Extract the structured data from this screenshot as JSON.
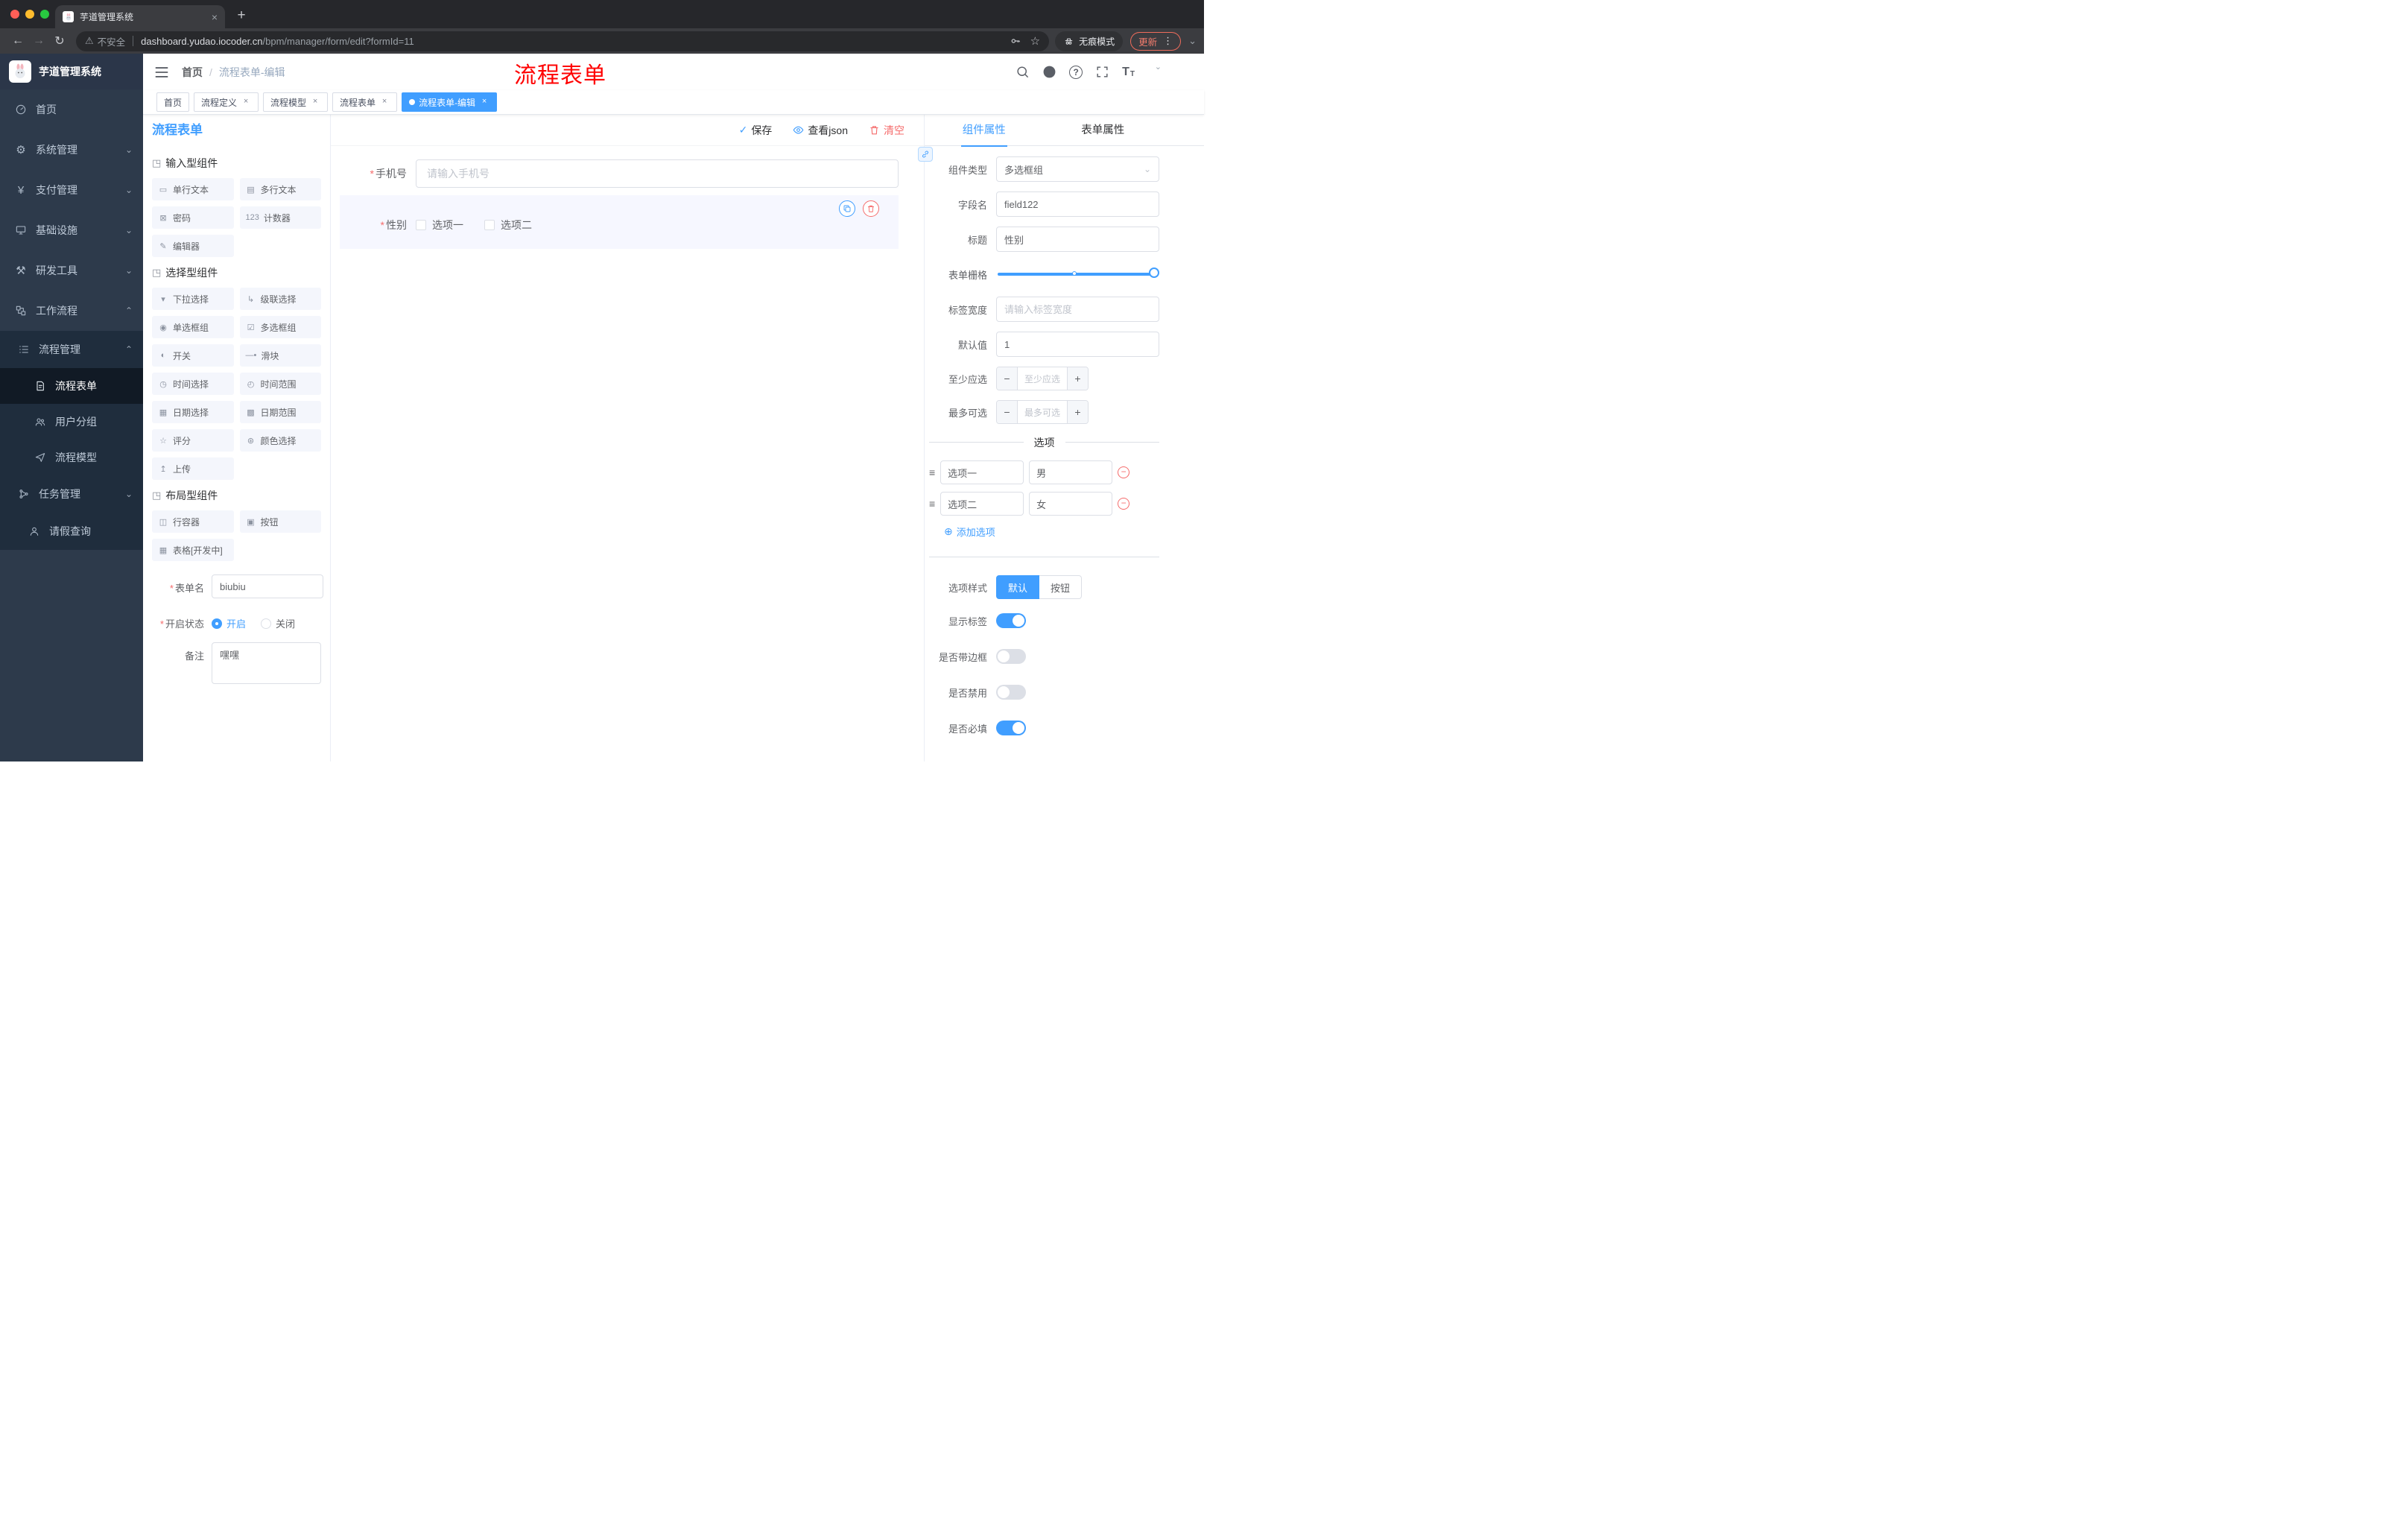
{
  "browser": {
    "tab_title": "芋道管理系统",
    "not_secure": "不安全",
    "url_domain": "dashboard.yudao.iocoder.cn",
    "url_path": "/bpm/manager/form/edit?formId=11",
    "incognito": "无痕模式",
    "update": "更新"
  },
  "sidebar": {
    "logo_title": "芋道管理系统",
    "items": [
      {
        "label": "首页",
        "icon": "gauge-icon"
      },
      {
        "label": "系统管理",
        "icon": "gear-icon"
      },
      {
        "label": "支付管理",
        "icon": "yen-icon"
      },
      {
        "label": "基础设施",
        "icon": "monitor-icon"
      },
      {
        "label": "研发工具",
        "icon": "tools-icon"
      },
      {
        "label": "工作流程",
        "icon": "flow-icon"
      }
    ],
    "process_mgmt": "流程管理",
    "process_form": "流程表单",
    "user_group": "用户分组",
    "process_model": "流程模型",
    "task_mgmt": "任务管理",
    "leave_query": "请假查询"
  },
  "header": {
    "breadcrumb_home": "首页",
    "breadcrumb_sep": "/",
    "breadcrumb_current": "流程表单-编辑",
    "annotation": "流程表单"
  },
  "tags": [
    {
      "label": "首页"
    },
    {
      "label": "流程定义"
    },
    {
      "label": "流程模型"
    },
    {
      "label": "流程表单"
    },
    {
      "label": "流程表单-编辑"
    }
  ],
  "designer": {
    "title": "流程表单",
    "toolbar": {
      "save": "保存",
      "view_json": "查看json",
      "clear": "清空"
    },
    "required_mark": "*",
    "groups": [
      {
        "title": "输入型组件",
        "items": [
          {
            "icon": "▭",
            "label": "单行文本"
          },
          {
            "icon": "▤",
            "label": "多行文本"
          },
          {
            "icon": "⊠",
            "label": "密码"
          },
          {
            "icon": "123",
            "label": "计数器"
          },
          {
            "icon": "✎",
            "label": "编辑器"
          }
        ]
      },
      {
        "title": "选择型组件",
        "items": [
          {
            "icon": "▾",
            "label": "下拉选择"
          },
          {
            "icon": "↳",
            "label": "级联选择"
          },
          {
            "icon": "◉",
            "label": "单选框组"
          },
          {
            "icon": "☑",
            "label": "多选框组"
          },
          {
            "icon": "◐",
            "label": "开关"
          },
          {
            "icon": "—•",
            "label": "滑块"
          },
          {
            "icon": "◷",
            "label": "时间选择"
          },
          {
            "icon": "◴",
            "label": "时间范围"
          },
          {
            "icon": "▦",
            "label": "日期选择"
          },
          {
            "icon": "▩",
            "label": "日期范围"
          },
          {
            "icon": "☆",
            "label": "评分"
          },
          {
            "icon": "⊛",
            "label": "颜色选择"
          },
          {
            "icon": "↥",
            "label": "上传"
          }
        ]
      },
      {
        "title": "布局型组件",
        "items": [
          {
            "icon": "◫",
            "label": "行容器"
          },
          {
            "icon": "▣",
            "label": "按钮"
          },
          {
            "icon": "▦",
            "label": "表格[开发中]"
          }
        ]
      }
    ],
    "meta": {
      "name_label": "表单名",
      "name_value": "biubiu",
      "status_label": "开启状态",
      "status_on": "开启",
      "status_off": "关闭",
      "remark_label": "备注",
      "remark_value": "嘿嘿"
    },
    "canvas": {
      "phone_label": "手机号",
      "phone_placeholder": "请输入手机号",
      "gender_label": "性别",
      "option1": "选项一",
      "option2": "选项二"
    }
  },
  "props": {
    "tab_component": "组件属性",
    "tab_form": "表单属性",
    "type_label": "组件类型",
    "type_value": "多选框组",
    "field_label": "字段名",
    "field_value": "field122",
    "title_label": "标题",
    "title_value": "性别",
    "grid_label": "表单栅格",
    "labelwidth_label": "标签宽度",
    "labelwidth_placeholder": "请输入标签宽度",
    "default_label": "默认值",
    "default_value": "1",
    "min_label": "至少应选",
    "min_placeholder": "至少应选",
    "max_label": "最多可选",
    "max_placeholder": "最多可选",
    "options_divider": "选项",
    "options": [
      {
        "name": "选项一",
        "value": "男"
      },
      {
        "name": "选项二",
        "value": "女"
      }
    ],
    "add_option": "添加选项",
    "style_label": "选项样式",
    "style_default": "默认",
    "style_button": "按钮",
    "switches": [
      {
        "label": "显示标签",
        "on": true
      },
      {
        "label": "是否带边框",
        "on": false
      },
      {
        "label": "是否禁用",
        "on": false
      },
      {
        "label": "是否必填",
        "on": true
      }
    ]
  },
  "icons": {
    "cube": "◳",
    "close": "×",
    "plus": "+",
    "back": "←",
    "forward": "→",
    "reload": "↻",
    "warning": "⚠",
    "star": "☆",
    "dots": "⋮",
    "chevron_down": "⌄",
    "chevron_up": "⌃",
    "check": "✓",
    "minus": "−",
    "drag": "≡",
    "circle_plus": "⊕",
    "question": "?",
    "t_large": "T",
    "t_small": "T",
    "select_caret": "⌄"
  },
  "accent_colors": {
    "primary": "#409eff",
    "danger": "#f56c6c",
    "annotation": "#ff0000"
  }
}
